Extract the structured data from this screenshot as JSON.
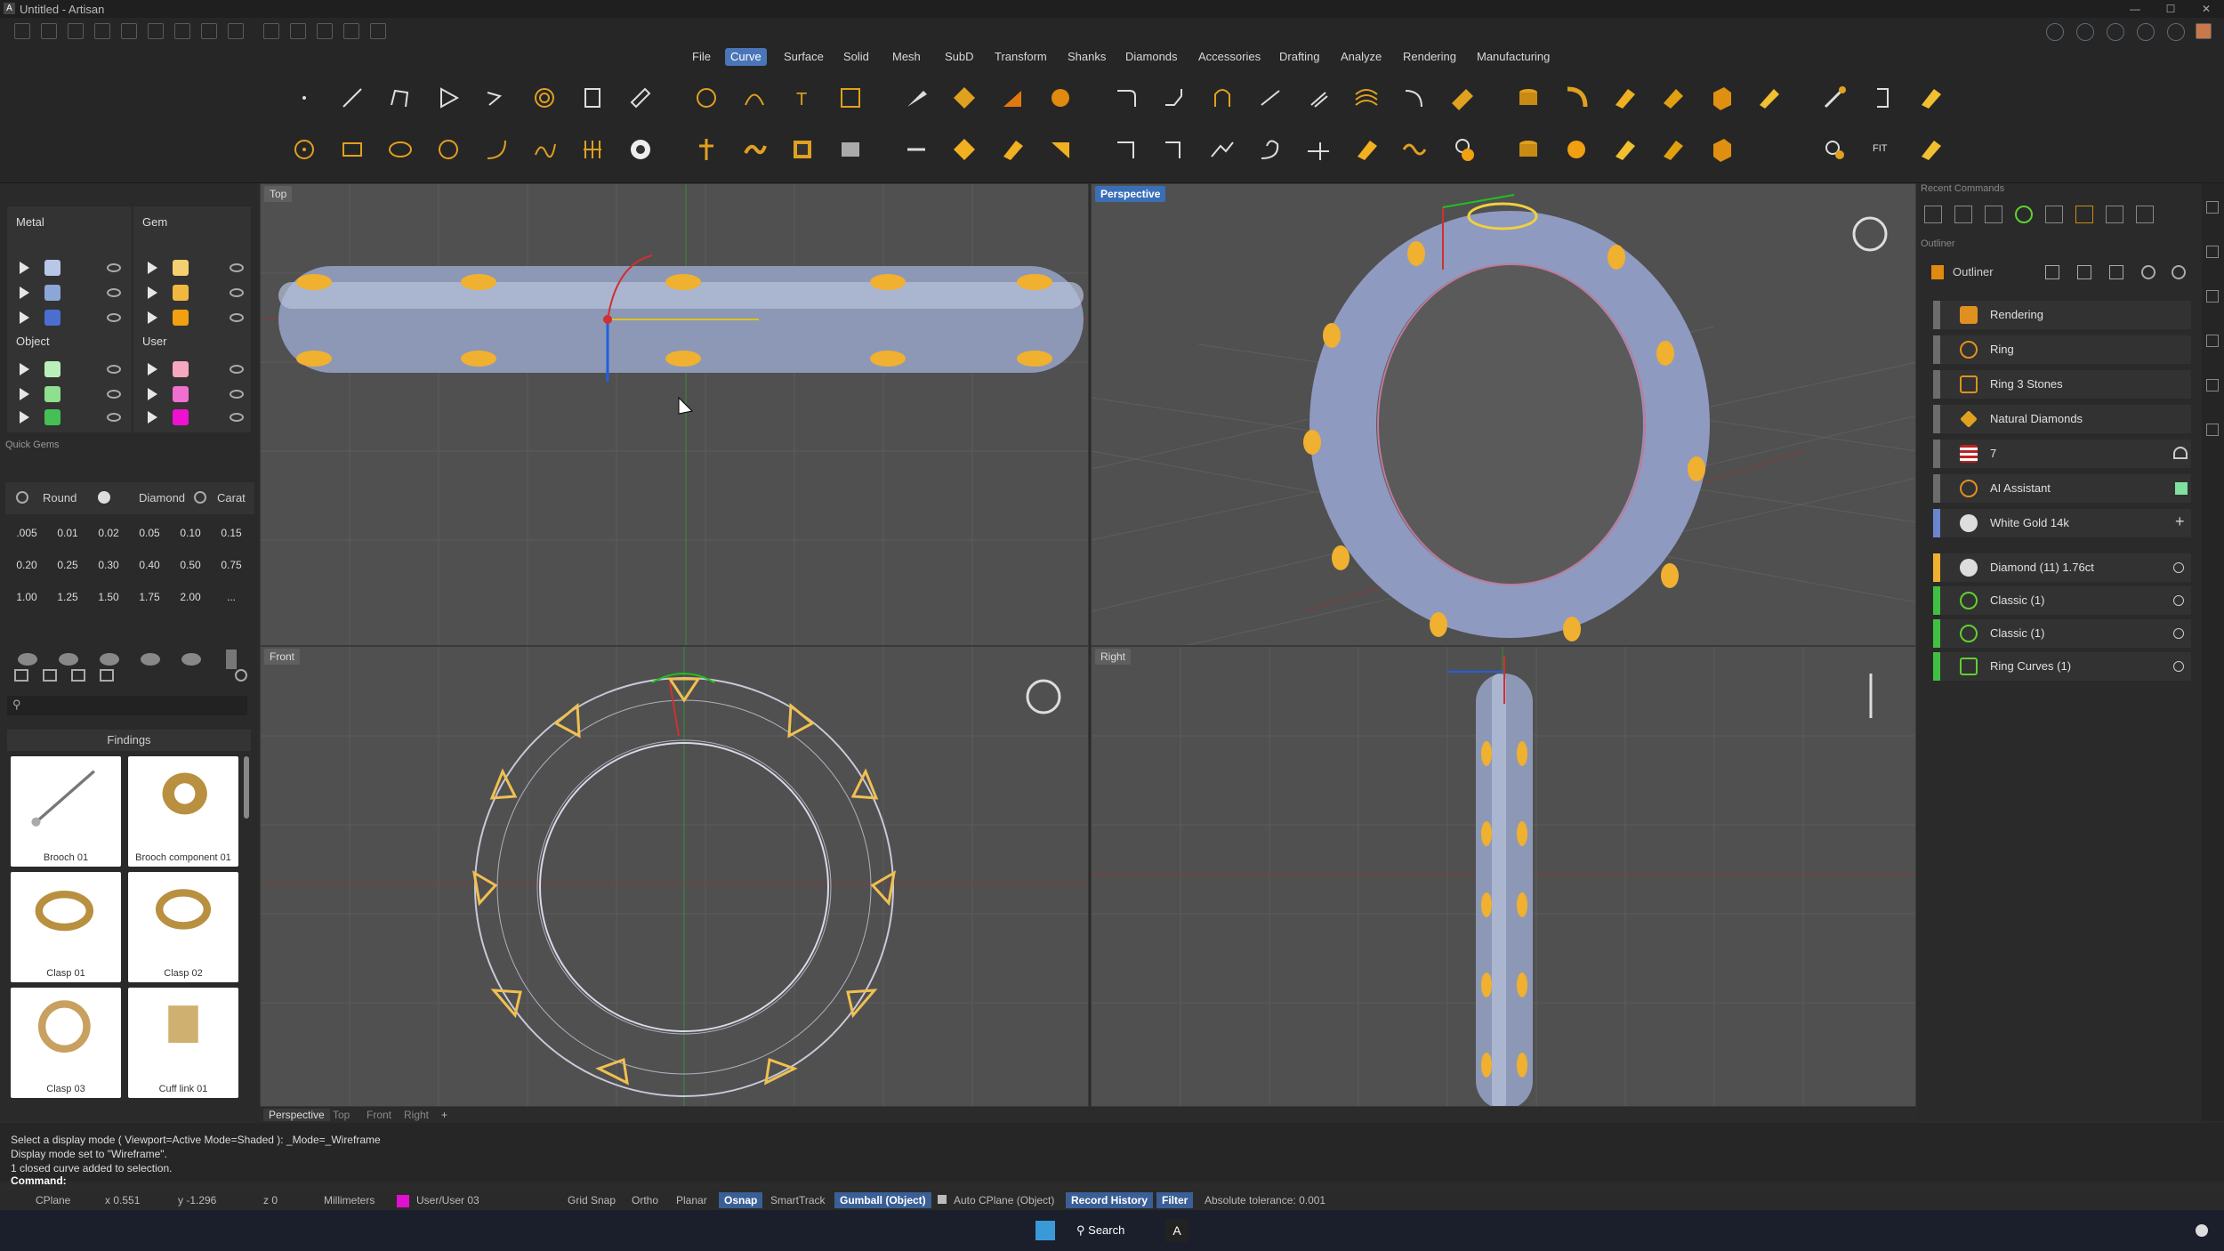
{
  "window": {
    "title": "Untitled - Artisan"
  },
  "menu": [
    "File",
    "Curve",
    "Surface",
    "Solid",
    "Mesh",
    "SubD",
    "Transform",
    "Shanks",
    "Diamonds",
    "Accessories",
    "Drafting",
    "Analyze",
    "Rendering",
    "Manufacturing"
  ],
  "active_menu": "Curve",
  "layers": {
    "metal": "Metal",
    "gem": "Gem",
    "object": "Object",
    "user": "User"
  },
  "quick_gems": {
    "title": "Quick Gems",
    "round": "Round",
    "diamond": "Diamond",
    "carat": "Carat",
    "sizes": [
      ".005",
      "0.01",
      "0.02",
      "0.05",
      "0.10",
      "0.15",
      "0.20",
      "0.25",
      "0.30",
      "0.40",
      "0.50",
      "0.75",
      "1.00",
      "1.25",
      "1.50",
      "1.75",
      "2.00",
      "..."
    ]
  },
  "library": {
    "category": "Findings",
    "items": [
      "Brooch 01",
      "Brooch component 01",
      "Clasp 01",
      "Clasp 02",
      "Clasp 03",
      "Cuff link 01"
    ]
  },
  "viewports": {
    "top": "Top",
    "perspective": "Perspective",
    "front": "Front",
    "right": "Right"
  },
  "viewport_tabs": [
    "Perspective",
    "Top",
    "Front",
    "Right",
    "+"
  ],
  "right": {
    "recent": "Recent Commands",
    "outliner_section": "Outliner",
    "outliner_title": "Outliner",
    "rows": [
      "Rendering",
      "Ring",
      "Ring 3 Stones",
      "Natural Diamonds",
      "7",
      "AI Assistant",
      "White Gold 14k",
      "Diamond (11) 1.76ct",
      "Classic (1)",
      "Classic (1)",
      "Ring Curves (1)"
    ]
  },
  "command": {
    "line1": "Select a display mode ( Viewport=Active  Mode=Shaded ): _Mode=_Wireframe",
    "line2": "Display mode set to \"Wireframe\".",
    "line3": "1 closed curve added to selection.",
    "prompt": "Command:"
  },
  "status": {
    "cplane": "CPlane",
    "x": "x 0.551",
    "y": "y -1.296",
    "z": "z 0",
    "units": "Millimeters",
    "layer": "User/User 03",
    "grid": "Grid Snap",
    "ortho": "Ortho",
    "planar": "Planar",
    "osnap": "Osnap",
    "smarttrack": "SmartTrack",
    "gumball": "Gumball (Object)",
    "autocplane": "Auto CPlane (Object)",
    "record": "Record History",
    "filter": "Filter",
    "tolerance": "Absolute tolerance: 0.001"
  },
  "taskbar": {
    "search": "Search"
  }
}
